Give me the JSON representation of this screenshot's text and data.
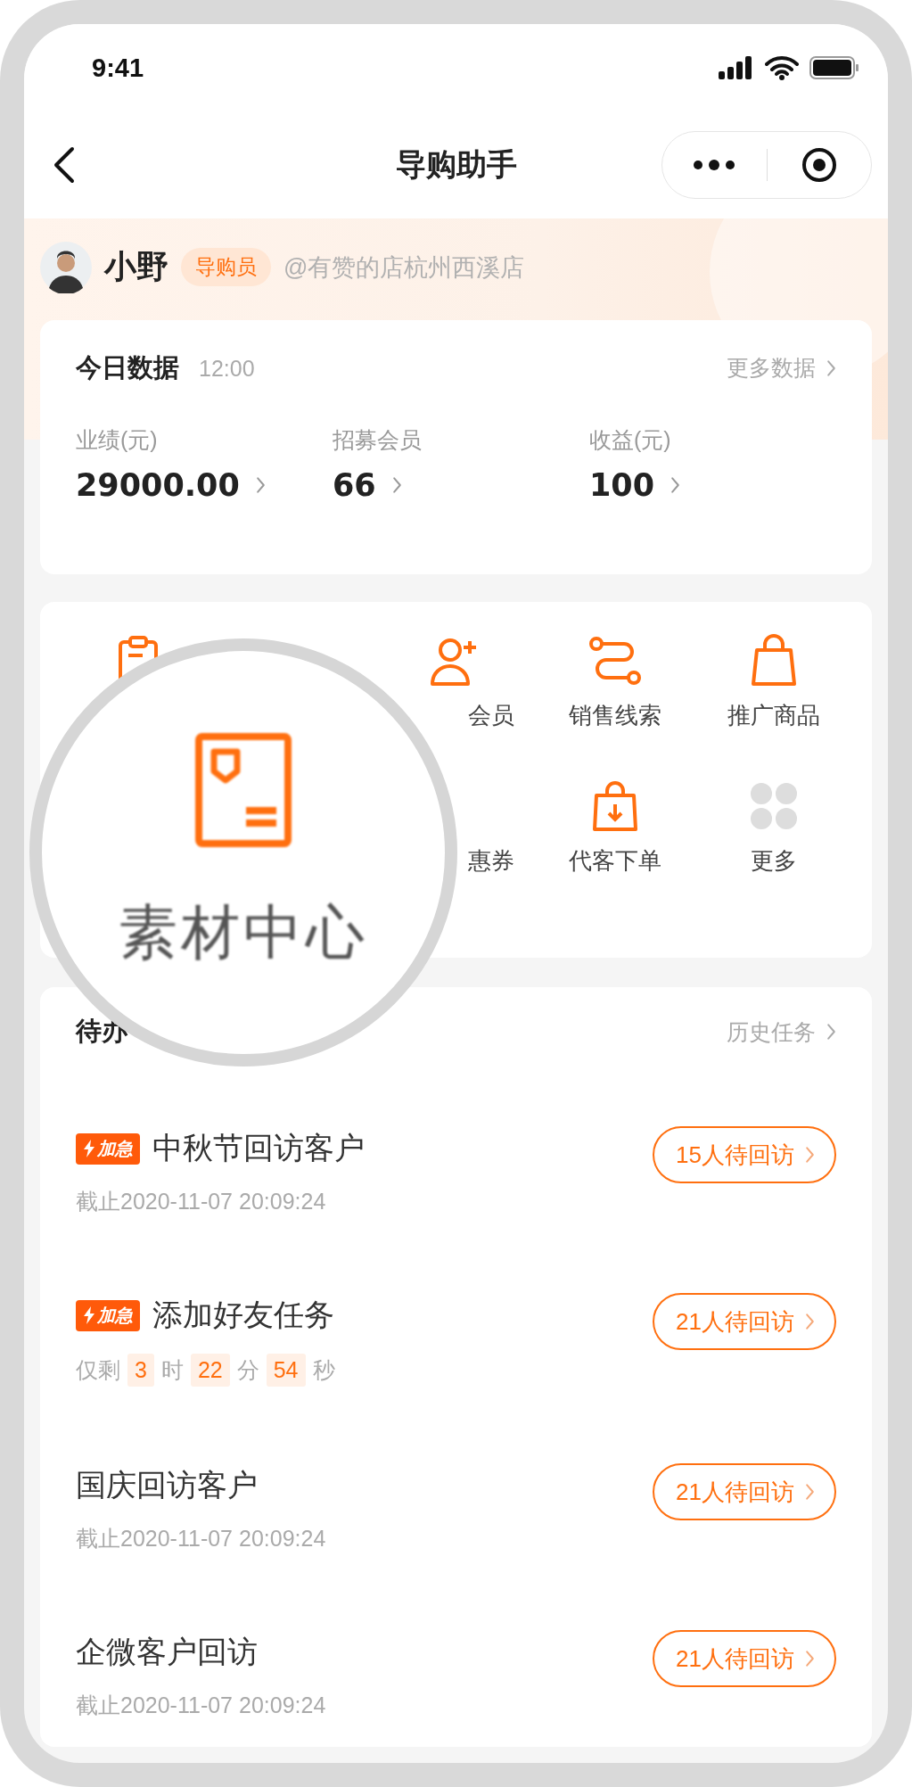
{
  "status_bar": {
    "time": "9:41"
  },
  "nav": {
    "title": "导购助手"
  },
  "user": {
    "name": "小野",
    "role": "导购员",
    "store": "@有赞的店杭州西溪店"
  },
  "today": {
    "title": "今日数据",
    "time": "12:00",
    "more": "更多数据",
    "stats": [
      {
        "label": "业绩(元)",
        "value": "29000.00"
      },
      {
        "label": "招募会员",
        "value": "66"
      },
      {
        "label": "收益(元)",
        "value": "100"
      }
    ]
  },
  "shortcuts": {
    "rows": [
      [
        {
          "label": "会员"
        },
        {
          "label": "销售线索"
        },
        {
          "label": "推广商品"
        }
      ],
      [
        {
          "label": "惠券"
        },
        {
          "label": "代客下单"
        },
        {
          "label": "更多"
        }
      ]
    ]
  },
  "magnifier": {
    "label": "素材中心"
  },
  "tasks": {
    "title": "待办",
    "history": "历史任务",
    "items": [
      {
        "urgent": true,
        "urgent_label": "加急",
        "title": "中秋节回访客户",
        "kind": "deadline",
        "deadline": "截止2020-11-07 20:09:24",
        "action": "15人待回访"
      },
      {
        "urgent": true,
        "urgent_label": "加急",
        "title": "添加好友任务",
        "kind": "countdown",
        "countdown": [
          "仅剩",
          "3",
          "时",
          "22",
          "分",
          "54",
          "秒"
        ],
        "action": "21人待回访"
      },
      {
        "urgent": false,
        "title": "国庆回访客户",
        "kind": "deadline",
        "deadline": "截止2020-11-07 20:09:24",
        "action": "21人待回访"
      },
      {
        "urgent": false,
        "title": "企微客户回访",
        "kind": "deadline",
        "deadline": "截止2020-11-07 20:09:24",
        "action": "21人待回访"
      }
    ]
  }
}
